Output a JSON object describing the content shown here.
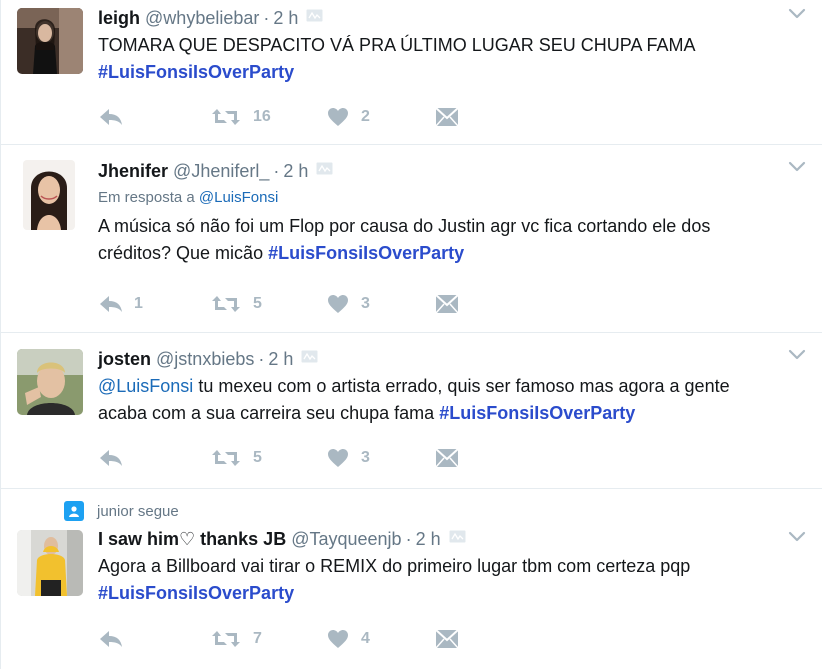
{
  "colors": {
    "hashtag": "#2b4ccc",
    "mention": "#1b6bb8",
    "muted": "#657786",
    "action": "#aab8c2",
    "border": "#e6ecf0"
  },
  "tweets": [
    {
      "fullname": "leigh",
      "username": "@whybeliebar",
      "dot": "·",
      "time": "2 h",
      "text": "TOMARA QUE DESPACITO VÁ PRA ÚLTIMO LUGAR SEU CHUPA FAMA",
      "hashtag": "#LuisFonsiIsOverParty",
      "retweets": "16",
      "likes": "2"
    },
    {
      "fullname": "Jhenifer",
      "username": "@Jheniferl_",
      "dot": "·",
      "time": "2 h",
      "reply_prefix": "Em resposta a",
      "reply_to": "@LuisFonsi",
      "text": "A música só não foi um Flop por causa do Justin agr vc fica cortando ele dos créditos? Que micão",
      "hashtag": "#LuisFonsiIsOverParty",
      "replies": "1",
      "retweets": "5",
      "likes": "3"
    },
    {
      "fullname": "josten",
      "username": "@jstnxbiebs",
      "dot": "·",
      "time": "2 h",
      "mention": "@LuisFonsi",
      "text": "tu mexeu com o artista errado, quis ser famoso mas agora a gente acaba com a sua carreira seu chupa fama",
      "hashtag": "#LuisFonsiIsOverParty",
      "retweets": "5",
      "likes": "3"
    },
    {
      "context": "junior segue",
      "fullname": "I saw him♡ thanks JB",
      "username": "@Tayqueenjb",
      "dot": "·",
      "time": "2 h",
      "text": "Agora a Billboard vai tirar o REMIX do primeiro lugar tbm com certeza pqp",
      "hashtag": "#LuisFonsiIsOverParty",
      "retweets": "7",
      "likes": "4"
    }
  ]
}
